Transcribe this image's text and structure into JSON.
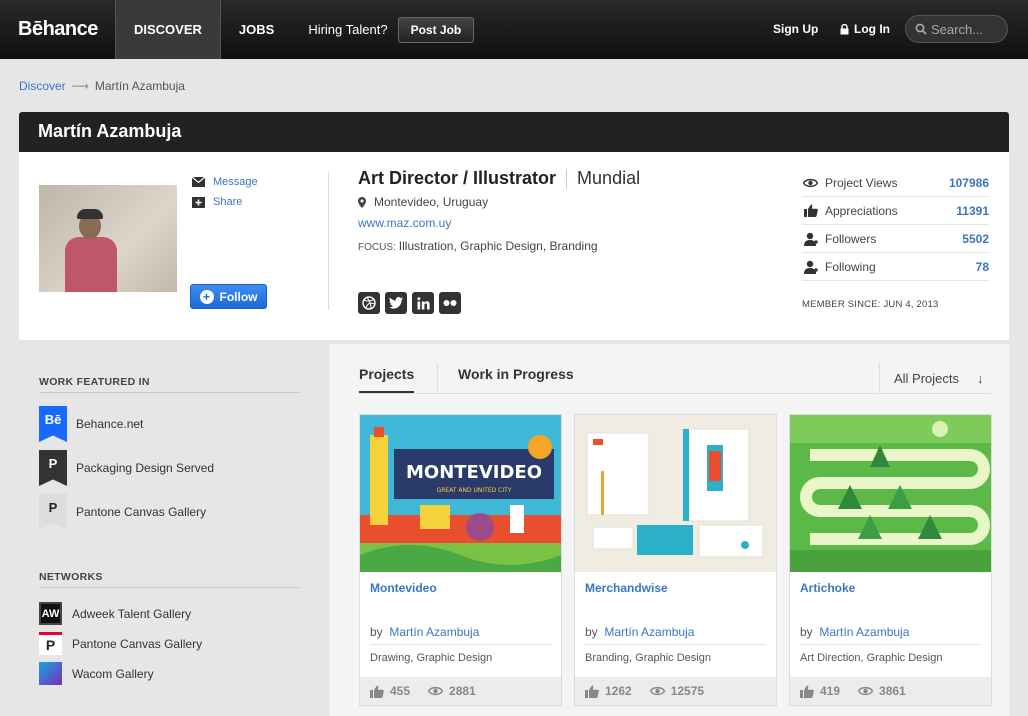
{
  "nav": {
    "logo": "Bēhance",
    "discover": "DISCOVER",
    "jobs": "JOBS",
    "hiring": "Hiring Talent?",
    "post_job": "Post Job",
    "sign_up": "Sign Up",
    "log_in": "Log In",
    "search_placeholder": "Search..."
  },
  "breadcrumb": {
    "root": "Discover",
    "arrow": "⟶",
    "current": "Martín Azambuja"
  },
  "profile": {
    "name": "Martín Azambuja",
    "message": "Message",
    "share": "Share",
    "follow": "Follow",
    "role": "Art Director / Illustrator",
    "company": "Mundial",
    "location": "Montevideo, Uruguay",
    "website": "www.maz.com.uy",
    "focus_label": "FOCUS:",
    "focus": "Illustration, Graphic Design, Branding",
    "socials": [
      "dribbble",
      "twitter",
      "linkedin",
      "flickr"
    ],
    "stats": [
      {
        "label": "Project Views",
        "value": "107986",
        "icon": "eye-icon"
      },
      {
        "label": "Appreciations",
        "value": "11391",
        "icon": "thumbs-up-icon"
      },
      {
        "label": "Followers",
        "value": "5502",
        "icon": "person-icon"
      },
      {
        "label": "Following",
        "value": "78",
        "icon": "person-icon"
      }
    ],
    "member_since": "MEMBER SINCE: JUN 4, 2013"
  },
  "sidebar": {
    "featured_title": "WORK FEATURED IN",
    "featured": [
      {
        "label": "Behance.net",
        "glyph": "Bē",
        "color": "#1769ff"
      },
      {
        "label": "Packaging Design Served",
        "glyph": "P",
        "color": "#333333"
      },
      {
        "label": "Pantone Canvas Gallery",
        "glyph": "P",
        "color": "#dddddd"
      }
    ],
    "networks_title": "NETWORKS",
    "networks": [
      {
        "label": "Adweek Talent Gallery",
        "glyph": "AW"
      },
      {
        "label": "Pantone Canvas Gallery",
        "glyph": "P"
      },
      {
        "label": "Wacom Gallery",
        "glyph": ""
      }
    ]
  },
  "main": {
    "tabs": [
      "Projects",
      "Work in Progress"
    ],
    "filter": "All Projects",
    "filter_arrow": "↓",
    "projects": [
      {
        "title": "Montevideo",
        "by": "by",
        "owner": "Martín Azambuja",
        "fields": "Drawing, Graphic Design",
        "likes": "455",
        "views": "2881"
      },
      {
        "title": "Merchandwise",
        "by": "by",
        "owner": "Martín Azambuja",
        "fields": "Branding, Graphic Design",
        "likes": "1262",
        "views": "12575"
      },
      {
        "title": "Artichoke",
        "by": "by",
        "owner": "Martín Azambuja",
        "fields": "Art Direction, Graphic Design",
        "likes": "419",
        "views": "3861"
      }
    ],
    "thumb_text": {
      "montevideo": "MONTEVIDEO",
      "montevideo_sub": "GREAT AND UNITED CITY"
    }
  }
}
